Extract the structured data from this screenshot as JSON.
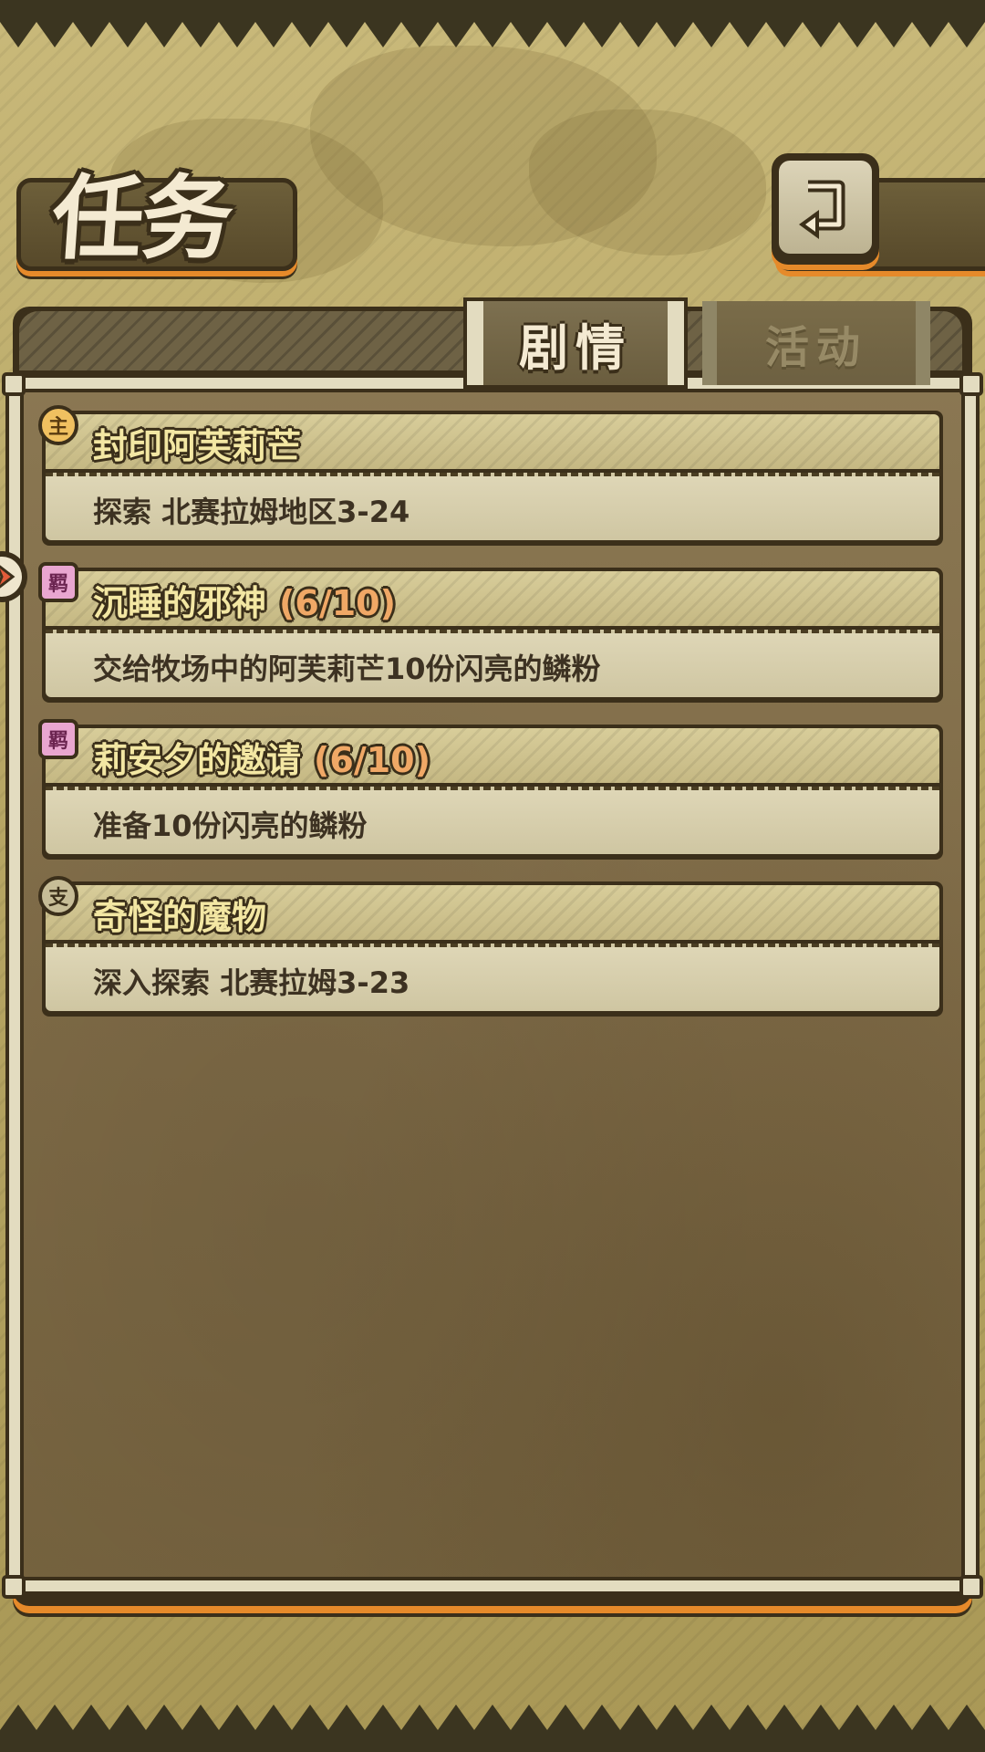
{
  "header": {
    "title": "任务"
  },
  "tabs": [
    {
      "label": "剧情",
      "active": true
    },
    {
      "label": "活动",
      "active": false
    }
  ],
  "quests": [
    {
      "badge": "主",
      "badge_type": "main",
      "title": "封印阿芙莉芒",
      "progress": "",
      "description": "探索 北赛拉姆地区3-24"
    },
    {
      "badge": "羁",
      "badge_type": "side",
      "title": "沉睡的邪神",
      "progress": "(6/10)",
      "description": "交给牧场中的阿芙莉芒10份闪亮的鳞粉"
    },
    {
      "badge": "羁",
      "badge_type": "side",
      "title": "莉安夕的邀请",
      "progress": "(6/10)",
      "description": "准备10份闪亮的鳞粉"
    },
    {
      "badge": "支",
      "badge_type": "branch",
      "title": "奇怪的魔物",
      "progress": "",
      "description": "深入探索 北赛拉姆3-23"
    }
  ],
  "icons": {
    "back": "back-arrow-icon",
    "side_arrow": "chevron-right-icon"
  },
  "colors": {
    "accent_orange": "#e68a2a",
    "frame_dark": "#3b2f1a",
    "parchment": "#ded6b6",
    "progress_text": "#f0a866"
  }
}
